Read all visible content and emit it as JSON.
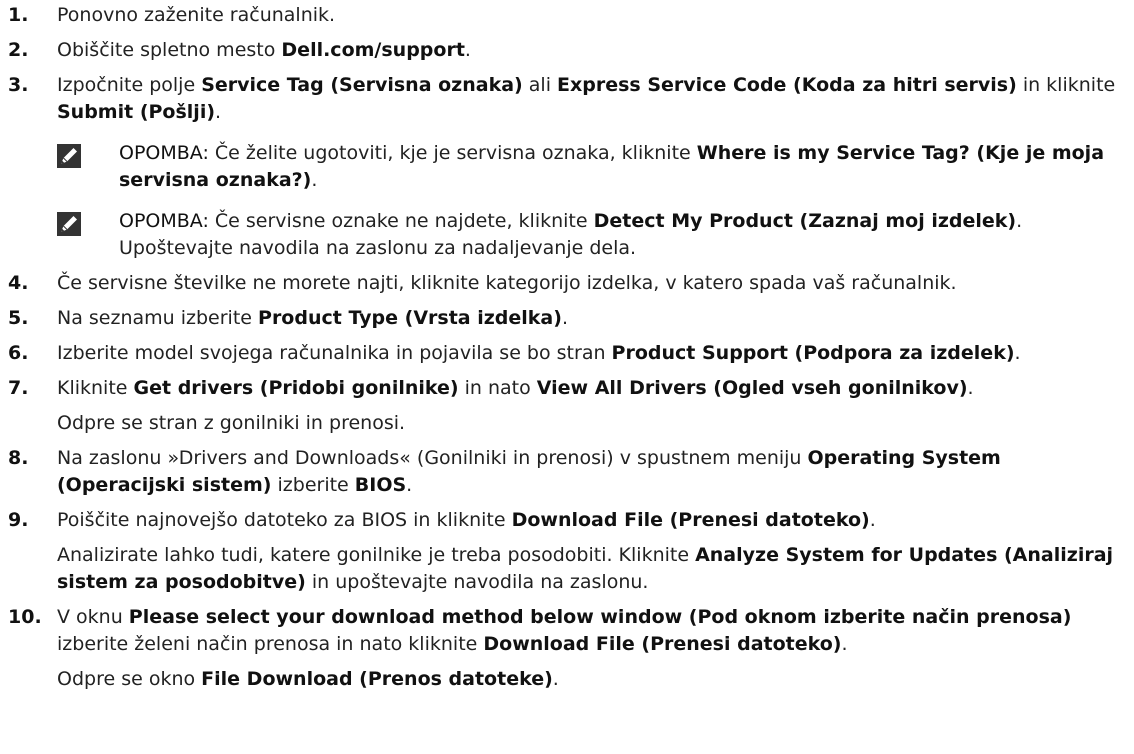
{
  "steps": [
    {
      "number": "1.",
      "parts": [
        [
          "t",
          "Ponovno zaženite računalnik."
        ]
      ]
    },
    {
      "number": "2.",
      "parts": [
        [
          "t",
          "Obiščite spletno mesto "
        ],
        [
          "b",
          "Dell.com/support"
        ],
        [
          "t",
          "."
        ]
      ]
    },
    {
      "number": "3.",
      "parts": [
        [
          "t",
          "Izpočnite polje "
        ],
        [
          "b",
          "Service Tag (Servisna oznaka)"
        ],
        [
          "t",
          " ali "
        ],
        [
          "b",
          "Express Service Code (Koda za hitri servis)"
        ],
        [
          "t",
          " in kliknite "
        ],
        [
          "b",
          "Submit (Pošlji)"
        ],
        [
          "t",
          "."
        ]
      ],
      "notes": [
        {
          "label": "OPOMBA:",
          "parts": [
            [
              "t",
              " Če želite ugotoviti, kje je servisna oznaka, kliknite "
            ],
            [
              "b",
              "Where is my Service Tag? (Kje je moja servisna oznaka?)"
            ],
            [
              "t",
              "."
            ]
          ]
        },
        {
          "label": "OPOMBA:",
          "parts": [
            [
              "t",
              " Če servisne oznake ne najdete, kliknite "
            ],
            [
              "b",
              "Detect My Product (Zaznaj moj izdelek)"
            ],
            [
              "t",
              ". Upoštevajte navodila na zaslonu za nadaljevanje dela."
            ]
          ]
        }
      ]
    },
    {
      "number": "4.",
      "parts": [
        [
          "t",
          "Če servisne številke ne morete najti, kliknite kategorijo izdelka, v katero spada vaš računalnik."
        ]
      ]
    },
    {
      "number": "5.",
      "parts": [
        [
          "t",
          "Na seznamu izberite "
        ],
        [
          "b",
          "Product Type (Vrsta izdelka)"
        ],
        [
          "t",
          "."
        ]
      ]
    },
    {
      "number": "6.",
      "parts": [
        [
          "t",
          "Izberite model svojega računalnika in pojavila se bo stran "
        ],
        [
          "b",
          "Product Support (Podpora za izdelek)"
        ],
        [
          "t",
          "."
        ]
      ]
    },
    {
      "number": "7.",
      "parts": [
        [
          "t",
          "Kliknite "
        ],
        [
          "b",
          "Get drivers (Pridobi gonilnike)"
        ],
        [
          "t",
          " in nato "
        ],
        [
          "b",
          "View All Drivers (Ogled vseh gonilnikov)"
        ],
        [
          "t",
          "."
        ]
      ],
      "extra": [
        [
          [
            "t",
            "Odpre se stran z gonilniki in prenosi."
          ]
        ]
      ]
    },
    {
      "number": "8.",
      "parts": [
        [
          "t",
          "Na zaslonu »Drivers and Downloads« (Gonilniki in prenosi) v spustnem meniju "
        ],
        [
          "b",
          "Operating System (Operacijski sistem)"
        ],
        [
          "t",
          " izberite "
        ],
        [
          "b",
          "BIOS"
        ],
        [
          "t",
          "."
        ]
      ]
    },
    {
      "number": "9.",
      "parts": [
        [
          "t",
          "Poiščite najnovejšo datoteko za BIOS in kliknite "
        ],
        [
          "b",
          "Download File (Prenesi datoteko)"
        ],
        [
          "t",
          "."
        ]
      ],
      "extra": [
        [
          [
            "t",
            "Analizirate lahko tudi, katere gonilnike je treba posodobiti. Kliknite "
          ],
          [
            "b",
            "Analyze System for Updates (Analiziraj sistem za posodobitve)"
          ],
          [
            "t",
            " in upoštevajte navodila na zaslonu."
          ]
        ]
      ]
    },
    {
      "number": "10.",
      "parts": [
        [
          "t",
          "V oknu "
        ],
        [
          "b",
          "Please select your download method below window (Pod oknom izberite način prenosa)"
        ],
        [
          "t",
          " izberite želeni način prenosa in nato kliknite "
        ],
        [
          "b",
          "Download File (Prenesi datoteko)"
        ],
        [
          "t",
          "."
        ]
      ],
      "extra": [
        [
          [
            "t",
            "Odpre se okno "
          ],
          [
            "b",
            "File Download (Prenos datoteke)"
          ],
          [
            "t",
            "."
          ]
        ]
      ]
    }
  ]
}
